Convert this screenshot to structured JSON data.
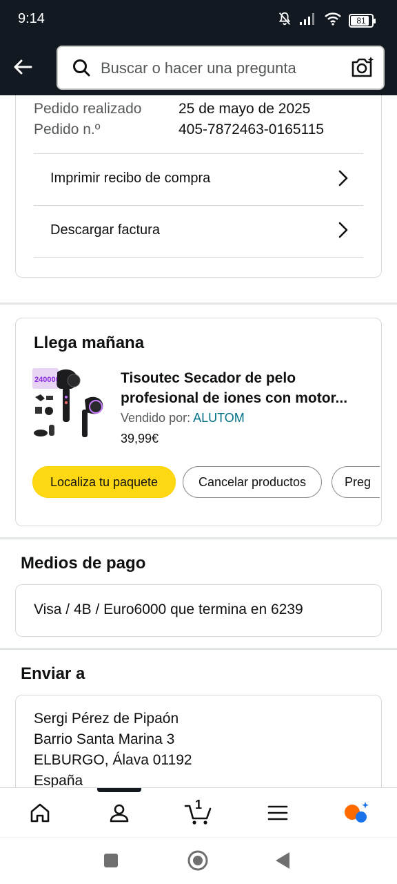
{
  "status_bar": {
    "time": "9:14",
    "battery": "81"
  },
  "header": {
    "search_placeholder": "Buscar o hacer una pregunta"
  },
  "order": {
    "placed_label": "Pedido realizado",
    "placed_value": "25 de mayo de 2025",
    "number_label": "Pedido n.º",
    "number_value": "405-7872463-0165115",
    "links": [
      "Imprimir recibo de compra",
      "Descargar factura"
    ]
  },
  "shipment": {
    "title": "Llega mañana",
    "product_title_line1": "Tisoutec Secador de pelo",
    "product_title_line2": "profesional de iones con motor...",
    "seller_label": "Vendido por:",
    "seller_name": "ALUTOM",
    "price": "39,99€",
    "buttons": [
      "Localiza tu paquete",
      "Cancelar productos",
      "Preg"
    ],
    "image_badge": "240000"
  },
  "payment": {
    "title": "Medios de pago",
    "method": "Visa / 4B / Euro6000  que termina en 6239"
  },
  "shipping": {
    "title": "Enviar a",
    "address": [
      "Sergi Pérez de Pipaón",
      "Barrio Santa Marina 3",
      "ELBURGO, Álava 01192",
      "España"
    ]
  },
  "bottom_nav": {
    "cart_count": "1"
  },
  "colors": {
    "header_bg": "#131921",
    "primary_button": "#ffd814",
    "link": "#007185",
    "alexa_orange": "#ff6a00",
    "alexa_blue": "#1a73e8"
  }
}
